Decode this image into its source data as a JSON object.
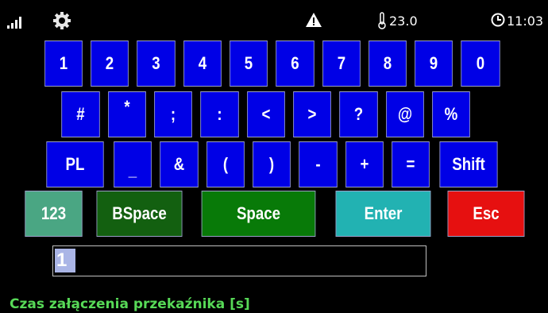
{
  "status": {
    "temperature": "23.0",
    "time": "11:03"
  },
  "keyboard": {
    "row1": [
      "1",
      "2",
      "3",
      "4",
      "5",
      "6",
      "7",
      "8",
      "9",
      "0"
    ],
    "row2": [
      "#",
      "*",
      ";",
      ":",
      "<",
      ">",
      "?",
      "@",
      "%"
    ],
    "row3": [
      "PL",
      "_",
      "&",
      "(",
      ")",
      "-",
      "+",
      "=",
      "Shift"
    ],
    "row4": [
      "123",
      "BSpace",
      "Space",
      "Enter",
      "Esc"
    ]
  },
  "input": {
    "value": "1"
  },
  "field_label": "Czas załączenia przekaźnika [s]",
  "colors": {
    "key_blue": "#0000e6",
    "key_123": "#4aa683",
    "key_bspace": "#136010",
    "key_space": "#087a08",
    "key_enter": "#22b2b2",
    "key_esc": "#e61010",
    "label_green": "#57d957"
  }
}
